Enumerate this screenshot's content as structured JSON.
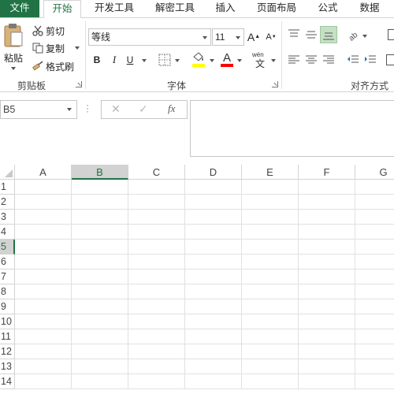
{
  "tabs": [
    {
      "label": "文件"
    },
    {
      "label": "开始"
    },
    {
      "label": "开发工具"
    },
    {
      "label": "解密工具"
    },
    {
      "label": "插入"
    },
    {
      "label": "页面布局"
    },
    {
      "label": "公式"
    },
    {
      "label": "数据"
    }
  ],
  "clipboard": {
    "paste_label": "粘贴",
    "cut_label": "剪切",
    "copy_label": "复制",
    "format_painter_label": "格式刷",
    "group_label": "剪贴板"
  },
  "font": {
    "font_name": "等线",
    "font_size": "11",
    "bold_label": "B",
    "italic_label": "I",
    "underline_label": "U",
    "grow_label": "A",
    "shrink_label": "A",
    "font_color_label": "A",
    "wen_label": "wén",
    "wen_char": "文",
    "group_label": "字体",
    "highlight_color": "#ffff00",
    "font_color": "#ff0000"
  },
  "alignment": {
    "group_label": "对齐方式"
  },
  "formula_bar": {
    "name_box": "B5",
    "cancel_icon": "✕",
    "enter_icon": "✓",
    "fx_label": "fx",
    "formula": ""
  },
  "sheet": {
    "columns": [
      "A",
      "B",
      "C",
      "D",
      "E",
      "F",
      "G"
    ],
    "rows": [
      "1",
      "2",
      "3",
      "4",
      "5",
      "6",
      "7",
      "8",
      "9",
      "10",
      "11",
      "12",
      "13",
      "14"
    ],
    "selected_column": "B",
    "selected_row": "5"
  },
  "colors": {
    "accent": "#217346"
  }
}
